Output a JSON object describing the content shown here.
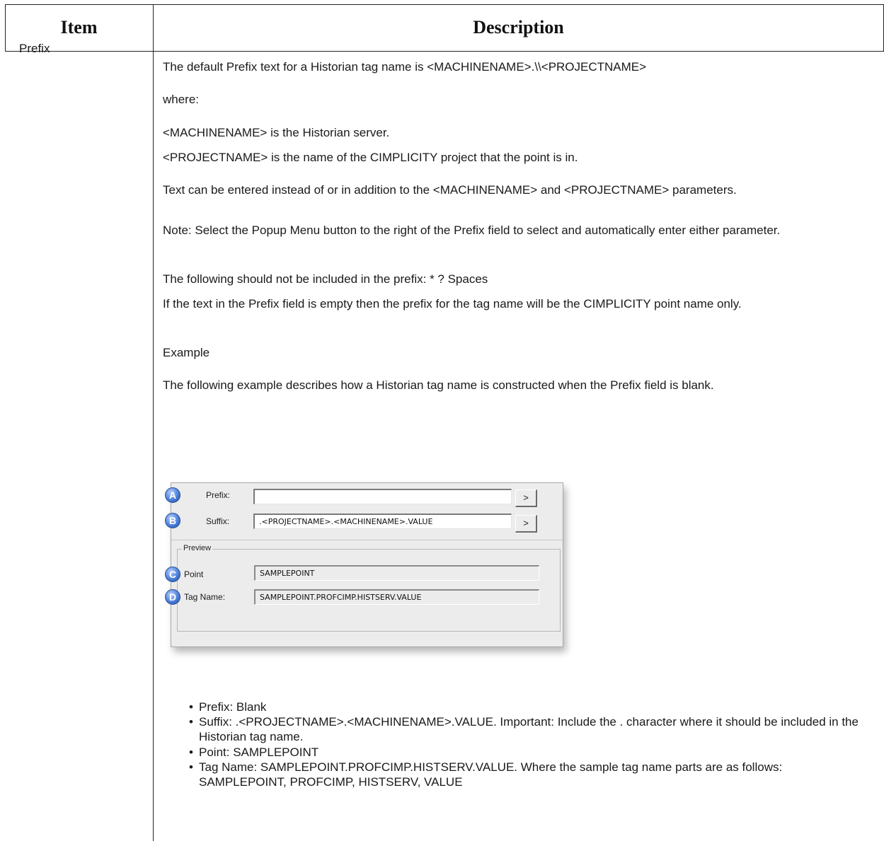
{
  "table": {
    "headers": {
      "item": "Item",
      "description": "Description"
    },
    "row": {
      "item": "Prefix",
      "paragraphs": [
        "The default Prefix text for a Historian tag name is <MACHINENAME>.\\\\<PROJECTNAME>",
        "where:",
        "<MACHINENAME> is the Historian server.",
        "<PROJECTNAME> is the name of the CIMPLICITY project that the point is in.",
        "Text can be entered instead of or in addition to the <MACHINENAME> and <PROJECTNAME> parameters.",
        "Note: Select the Popup Menu button to the right of the Prefix field to select and automatically enter either parameter.",
        "The following should not be included in the prefix: * ? Spaces",
        "If the text in the Prefix field is empty then the prefix for the tag name will be the CIMPLICITY point name only.",
        "Example",
        "The following example describes how a Historian tag name is constructed when the Prefix field is blank."
      ],
      "bullets": [
        "Prefix: Blank",
        "Suffix: .<PROJECTNAME>.<MACHINENAME>.VALUE. Important: Include the . character where it should be included in the Historian tag name.",
        "Point: SAMPLEPOINT",
        "Tag Name: SAMPLEPOINT.PROFCIMP.HISTSERV.VALUE. Where the sample tag name parts are as follows: SAMPLEPOINT, PROFCIMP, HISTSERV, VALUE"
      ]
    }
  },
  "dialog": {
    "badges": [
      "A",
      "B",
      "C",
      "D"
    ],
    "prefix_label": "Prefix:",
    "prefix_value": "",
    "suffix_label": "Suffix:",
    "suffix_value": ".<PROJECTNAME>.<MACHINENAME>.VALUE",
    "popup_button_label": ">",
    "preview_group_label": "Preview",
    "point_label": "Point",
    "point_value": "SAMPLEPOINT",
    "tagname_label": "Tag Name:",
    "tagname_value": "SAMPLEPOINT.PROFCIMP.HISTSERV.VALUE"
  }
}
